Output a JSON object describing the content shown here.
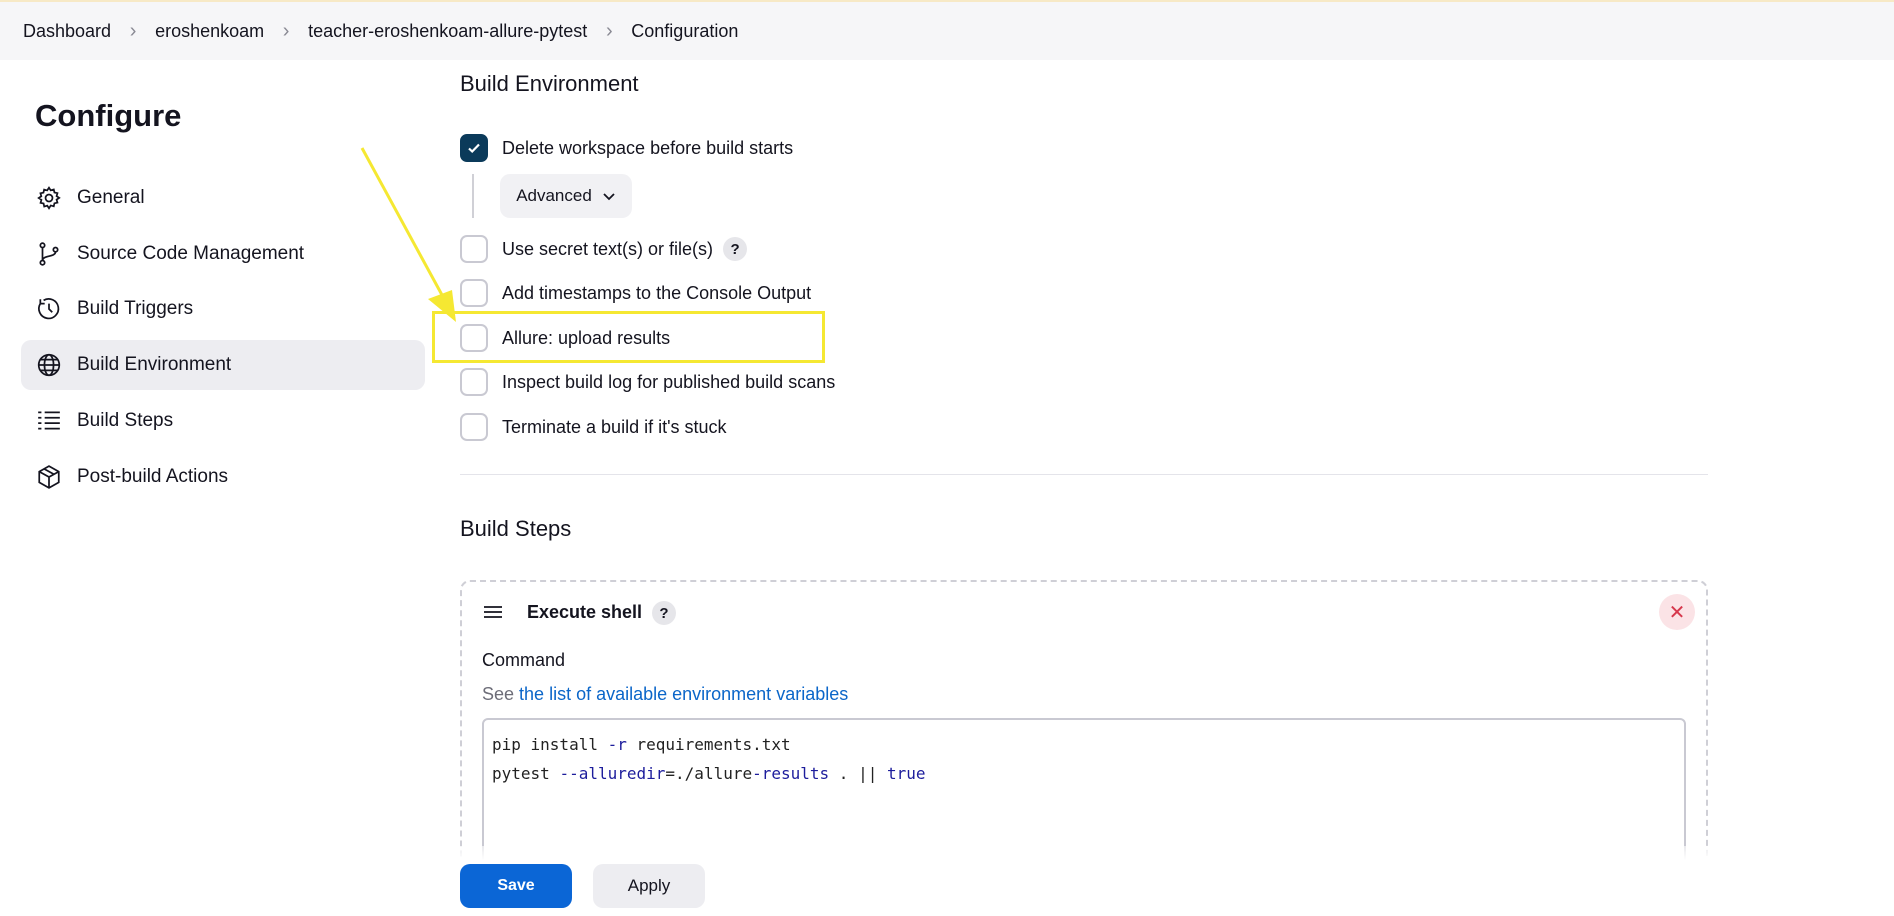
{
  "breadcrumb": [
    "Dashboard",
    "eroshenkoam",
    "teacher-eroshenkoam-allure-pytest",
    "Configuration"
  ],
  "sidebar": {
    "title": "Configure",
    "items": [
      {
        "label": "General",
        "icon": "gear-icon"
      },
      {
        "label": "Source Code Management",
        "icon": "git-branch-icon"
      },
      {
        "label": "Build Triggers",
        "icon": "clock-icon"
      },
      {
        "label": "Build Environment",
        "icon": "globe-icon",
        "active": true
      },
      {
        "label": "Build Steps",
        "icon": "list-icon"
      },
      {
        "label": "Post-build Actions",
        "icon": "package-icon"
      }
    ]
  },
  "build_environment": {
    "title": "Build Environment",
    "options": [
      {
        "label": "Delete workspace before build starts",
        "checked": true
      },
      {
        "label": "Use secret text(s) or file(s)",
        "checked": false,
        "help": "?"
      },
      {
        "label": "Add timestamps to the Console Output",
        "checked": false
      },
      {
        "label": "Allure: upload results",
        "checked": false
      },
      {
        "label": "Inspect build log for published build scans",
        "checked": false
      },
      {
        "label": "Terminate a build if it's stuck",
        "checked": false
      }
    ],
    "advanced_label": "Advanced"
  },
  "build_steps": {
    "title": "Build Steps",
    "step_title": "Execute shell",
    "help": "?",
    "command_label": "Command",
    "hint_prefix": "See",
    "hint_link": "the list of available environment variables",
    "command_lines": [
      "pip install -r requirements.txt",
      "pytest --alluredir=./allure-results . || true"
    ]
  },
  "footer": {
    "save_label": "Save",
    "apply_label": "Apply"
  },
  "colors": {
    "accent": "#0b66d6",
    "highlight": "#f5e832",
    "checkbox_checked": "#0b3a5a"
  }
}
